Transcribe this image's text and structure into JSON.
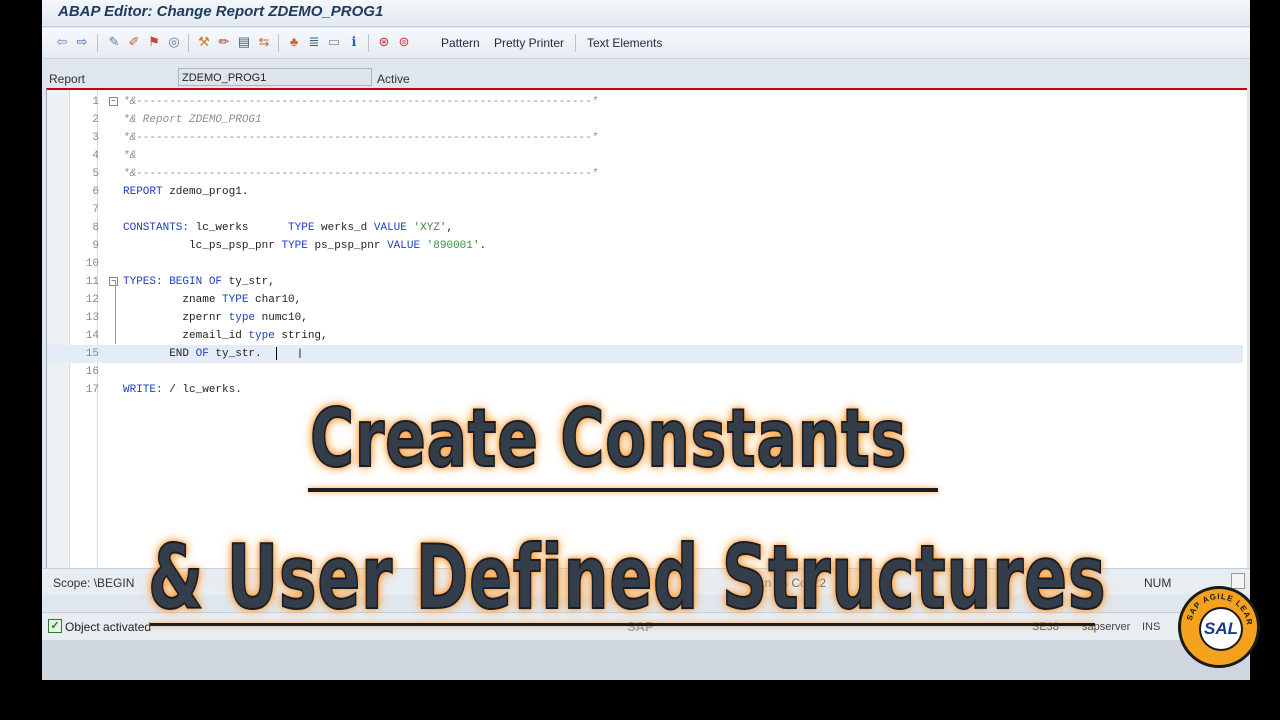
{
  "window": {
    "title": "ABAP Editor: Change Report ZDEMO_PROG1"
  },
  "toolbar": {
    "icons": [
      "back-arrow-icon",
      "forward-arrow-icon",
      "other-object-icon",
      "display-change-icon",
      "active-inactive-icon",
      "check-icon",
      "activate-icon",
      "test-icon",
      "where-used-icon",
      "object-list-icon",
      "display-object-list-icon",
      "navigation-window-icon",
      "breakpoint-icon",
      "set-breakpoint-icon",
      "help-icon",
      "info-icon",
      "block-icon",
      "find-icon"
    ],
    "pattern_label": "Pattern",
    "pretty_printer_label": "Pretty Printer",
    "text_elements_label": "Text Elements"
  },
  "report": {
    "label": "Report",
    "name": "ZDEMO_PROG1",
    "status": "Active"
  },
  "editor": {
    "lines": [
      {
        "n": "1"
      },
      {
        "n": "2"
      },
      {
        "n": "3"
      },
      {
        "n": "4"
      },
      {
        "n": "5"
      },
      {
        "n": "6"
      },
      {
        "n": "7"
      },
      {
        "n": "8"
      },
      {
        "n": "9"
      },
      {
        "n": "10"
      },
      {
        "n": "11"
      },
      {
        "n": "12"
      },
      {
        "n": "13"
      },
      {
        "n": "14"
      },
      {
        "n": "15"
      },
      {
        "n": "16"
      },
      {
        "n": "17"
      }
    ],
    "code": {
      "l1": "*&---------------------------------------------------------------------*",
      "l2": "*& Report ZDEMO_PROG1",
      "l3": "*&---------------------------------------------------------------------*",
      "l4": "*&",
      "l5": "*&---------------------------------------------------------------------*",
      "l6_kw": "REPORT",
      "l6_rest": " zdemo_prog1.",
      "l8_kw": "CONSTANTS:",
      "l8_a": " lc_werks      ",
      "l8_kw2": "TYPE",
      "l8_b": " werks_d ",
      "l8_kw3": "VALUE",
      "l8_s": " 'XYZ'",
      "l8_end": ",",
      "l9_a": "          lc_ps_psp_pnr ",
      "l9_kw": "TYPE",
      "l9_b": " ps_psp_pnr ",
      "l9_kw2": "VALUE",
      "l9_s": " '890001'",
      "l9_end": ".",
      "l11_kw": "TYPES:",
      "l11_kw2": " BEGIN OF",
      "l11_rest": " ty_str,",
      "l12_a": "         zname ",
      "l12_kw": "TYPE",
      "l12_b": " char10,",
      "l13_a": "         zpernr ",
      "l13_kw": "type",
      "l13_b": " numc10,",
      "l14_a": "         zemail_id ",
      "l14_kw": "type",
      "l14_b": " string,",
      "l15_kw": "       END",
      "l15_kw2": " OF",
      "l15_rest": " ty_str.",
      "l17_kw": "WRITE:",
      "l17_rest": " / lc_werks."
    }
  },
  "status": {
    "scope": "Scope: \\BEGIN",
    "position": "Ln  15 Col  22",
    "num": "NUM"
  },
  "message": {
    "text": "Object activated",
    "sap": "SAP",
    "transaction": "SE38",
    "server": "sapserver",
    "mode": "INS"
  },
  "overlay": {
    "line1": "Create Constants",
    "line2": "& User Defined Structures"
  },
  "logo": {
    "ring_text": "SAP AGILE LEARNERS",
    "initials": "SAL"
  },
  "colors": {
    "keyword": "#1f3fbf",
    "string": "#3c8c3c",
    "comment": "#8e8e8e",
    "glow": "#ff9e3a",
    "logo": "#f4a21d"
  }
}
